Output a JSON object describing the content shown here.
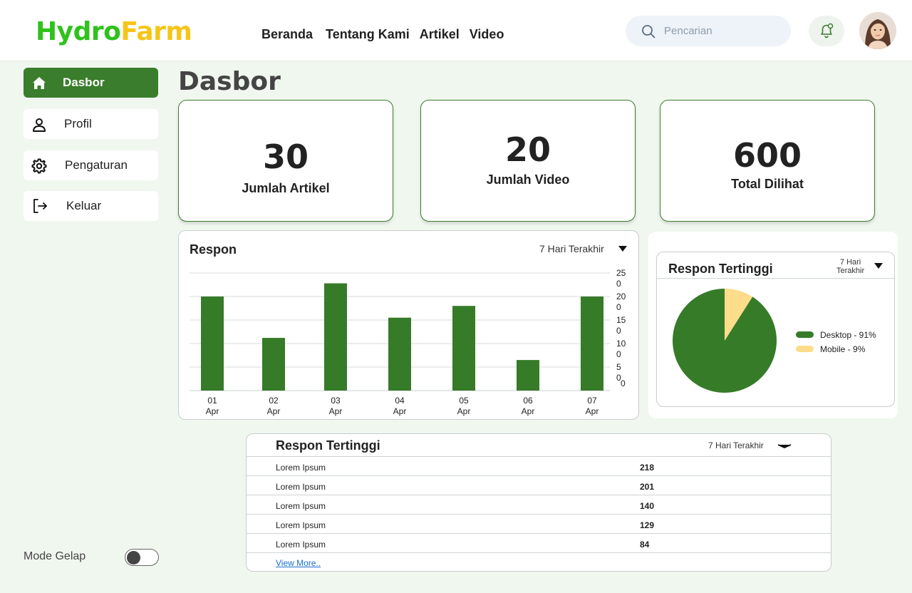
{
  "header": {
    "logo_part1": "Hydro",
    "logo_part2": "Farm",
    "nav": [
      "Beranda",
      "Tentang Kami",
      "Artikel",
      "Video"
    ],
    "search_placeholder": "Pencarian"
  },
  "sidebar": {
    "items": [
      {
        "label": "Dasbor",
        "icon": "home-icon",
        "active": true
      },
      {
        "label": "Profil",
        "icon": "user-icon",
        "active": false
      },
      {
        "label": "Pengaturan",
        "icon": "gear-icon",
        "active": false
      },
      {
        "label": "Keluar",
        "icon": "logout-icon",
        "active": false
      }
    ],
    "mode_label": "Mode Gelap",
    "dark_mode": false
  },
  "page_title": "Dasbor",
  "stats": [
    {
      "value": "30",
      "label": "Jumlah Artikel"
    },
    {
      "value": "20",
      "label": "Jumlah Video"
    },
    {
      "value": "600",
      "label": "Total Dilihat"
    }
  ],
  "colors": {
    "accent": "#3a7d2c",
    "bar": "#367b28",
    "mobile": "#fddc8a",
    "logo_green": "#2ec21b",
    "logo_yellow": "#f5c518"
  },
  "response_chart": {
    "title": "Respon",
    "range": "7 Hari Terakhir"
  },
  "chart_data": [
    {
      "type": "bar",
      "title": "Respon",
      "categories": [
        "01 Apr",
        "02 Apr",
        "03 Apr",
        "04 Apr",
        "05 Apr",
        "06 Apr",
        "07 Apr"
      ],
      "category_lines": [
        [
          "01",
          "Apr"
        ],
        [
          "02",
          "Apr"
        ],
        [
          "03",
          "Apr"
        ],
        [
          "04",
          "Apr"
        ],
        [
          "05",
          "Apr"
        ],
        [
          "06",
          "Apr"
        ],
        [
          "07",
          "Apr"
        ]
      ],
      "values": [
        200,
        112,
        228,
        155,
        180,
        65,
        200
      ],
      "ylim": [
        0,
        250
      ],
      "yticks": [
        {
          "value": 250,
          "lines": [
            "25",
            "0"
          ]
        },
        {
          "value": 200,
          "lines": [
            "20",
            "0"
          ]
        },
        {
          "value": 150,
          "lines": [
            "15",
            "0"
          ]
        },
        {
          "value": 100,
          "lines": [
            "10",
            "0"
          ]
        },
        {
          "value": 50,
          "lines": [
            "5",
            "0"
          ]
        }
      ],
      "grid": true,
      "yaxis_side": "right"
    },
    {
      "type": "pie",
      "title": "Respon Tertinggi",
      "slices": [
        {
          "label": "Desktop - 91%",
          "value": 91
        },
        {
          "label": "Mobile - 9%",
          "value": 9
        }
      ],
      "legend_placement": "right"
    }
  ],
  "pie_card": {
    "title": "Respon Tertinggi",
    "range_line1": "7 Hari",
    "range_line2": "Terakhir"
  },
  "table_card": {
    "title": "Respon Tertinggi",
    "range": "7 Hari Terakhir",
    "rows": [
      {
        "name": "Lorem Ipsum",
        "value": "218"
      },
      {
        "name": "Lorem Ipsum",
        "value": "201"
      },
      {
        "name": "Lorem Ipsum",
        "value": "140"
      },
      {
        "name": "Lorem Ipsum",
        "value": "129"
      },
      {
        "name": "Lorem Ipsum",
        "value": "84"
      }
    ],
    "view_more": "View More.."
  }
}
